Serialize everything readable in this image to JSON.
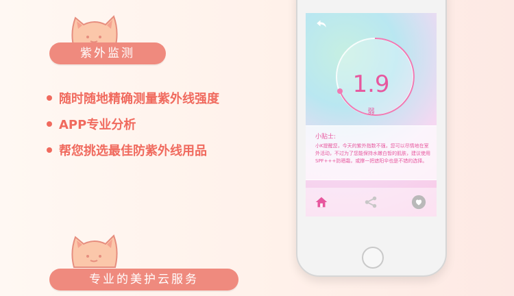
{
  "section1": {
    "title": "紫外监测"
  },
  "bullets": [
    "随时随地精确测量紫外线强度",
    "APP专业分析",
    "帮您挑选最佳防紫外线用品"
  ],
  "section2": {
    "title": "专业的美护云服务"
  },
  "app": {
    "uv_value": "1.9",
    "uv_level": "弱",
    "tip_title": "小贴士:",
    "tip_text": "小K提醒您，今天的紫外指数不强，您可以尽情地在室外活动，不过为了您能保持水嫩白皙的肌肤，建议使用SPF+++防晒霜，或撑一把遮阳伞也是不错的选择。"
  },
  "icons": [
    "cat-icon",
    "back-arrow-icon",
    "home-icon",
    "user-heart-icon",
    "share-icon"
  ],
  "colors": {
    "pill": "#ef8a7e",
    "bullet": "#f06a5e",
    "accent": "#e7579e"
  }
}
